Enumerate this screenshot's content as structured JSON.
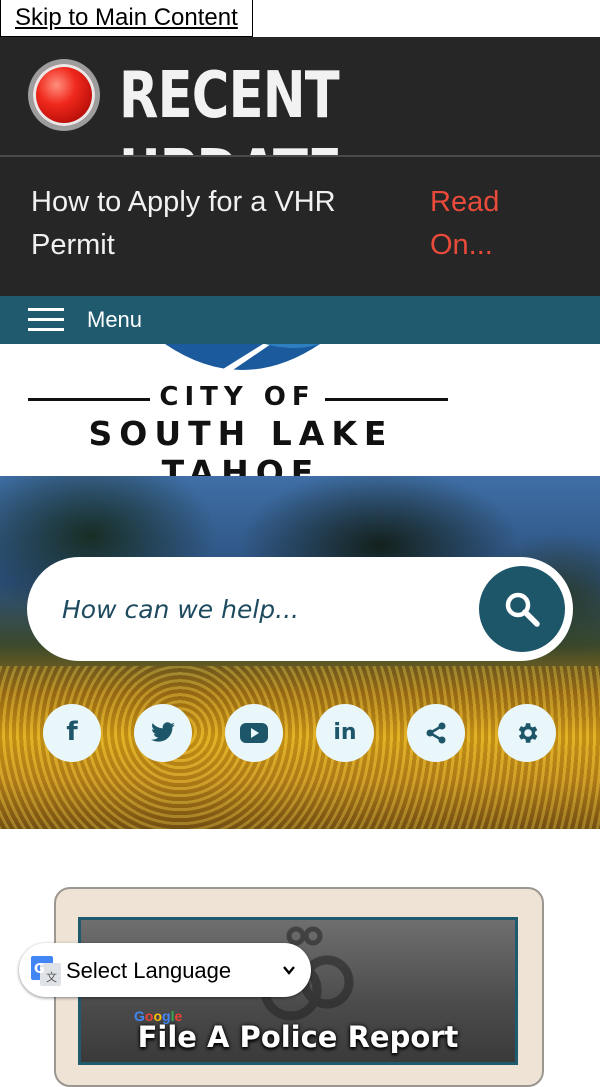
{
  "skip_link": "Skip to Main Content",
  "alert": {
    "title": "RECENT UPDATE",
    "headline": "How to Apply for a VHR Permit",
    "read_more": "Read On..."
  },
  "nav": {
    "menu_label": "Menu"
  },
  "logo": {
    "line1": "CITY OF",
    "line2": "SOUTH LAKE TAHOE"
  },
  "search": {
    "placeholder": "How can we help..."
  },
  "social": [
    {
      "name": "facebook-icon",
      "glyph": "f"
    },
    {
      "name": "twitter-icon",
      "glyph": ""
    },
    {
      "name": "youtube-icon",
      "glyph": ""
    },
    {
      "name": "linkedin-icon",
      "glyph": "in"
    },
    {
      "name": "share-icon",
      "glyph": ""
    },
    {
      "name": "gear-icon",
      "glyph": ""
    }
  ],
  "quick_link": {
    "title": "File A Police Report"
  },
  "translate": {
    "label": "Select Language",
    "powered_by": "Google"
  },
  "colors": {
    "alert_bg": "#262626",
    "accent_red": "#ea4a3a",
    "nav_teal": "#1f5a6f",
    "icon_bg": "#e9f7fa"
  }
}
